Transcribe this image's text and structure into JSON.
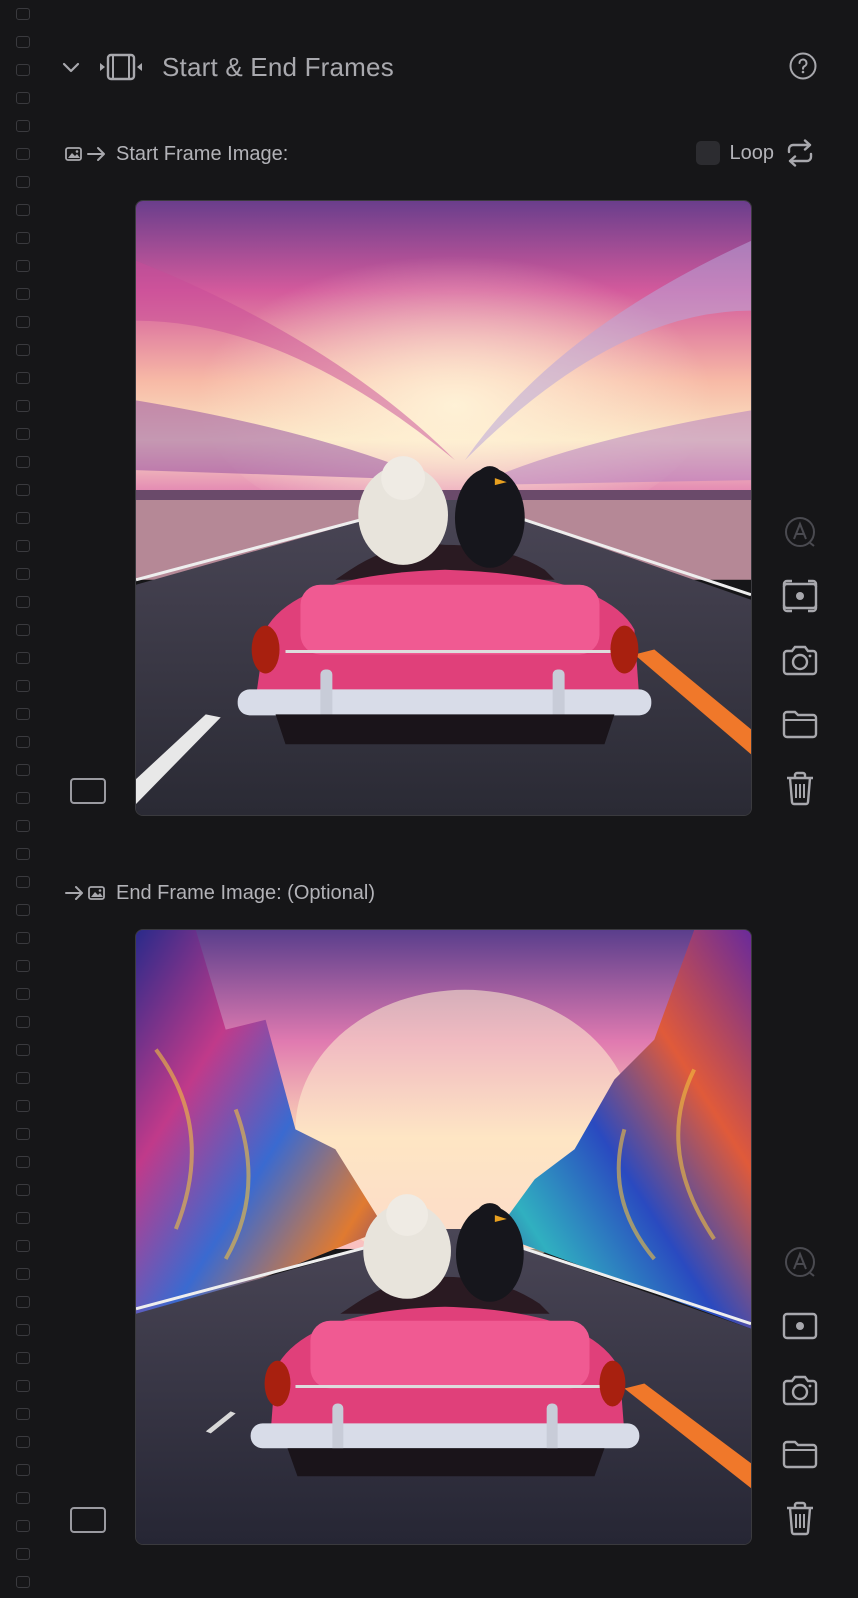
{
  "header": {
    "title": "Start & End Frames",
    "chevron_icon": "chevron-down-icon",
    "section_icon": "film-frame-icon",
    "help_icon": "help-circle-icon"
  },
  "start_frame": {
    "label": "Start Frame Image:",
    "label_icon": "image-arrow-right-icon",
    "loop_label": "Loop",
    "loop_checked": false,
    "loop_icon": "repeat-icon",
    "image_description_icon": "car-on-road-image"
  },
  "end_frame": {
    "label": "End Frame Image: (Optional)",
    "label_icon": "arrow-right-image-icon",
    "image_description_icon": "car-on-road-image"
  },
  "side_actions": [
    {
      "name": "auto-caption-icon",
      "enabled": false
    },
    {
      "name": "screen-capture-icon",
      "enabled": true
    },
    {
      "name": "camera-icon",
      "enabled": true
    },
    {
      "name": "folder-icon",
      "enabled": true
    },
    {
      "name": "trash-icon",
      "enabled": true
    }
  ],
  "colors": {
    "background": "#161618",
    "text": "#b3b3b8",
    "icon": "#a8a8ad",
    "car": "#e0407a",
    "road_stripe": "#f0782a"
  }
}
